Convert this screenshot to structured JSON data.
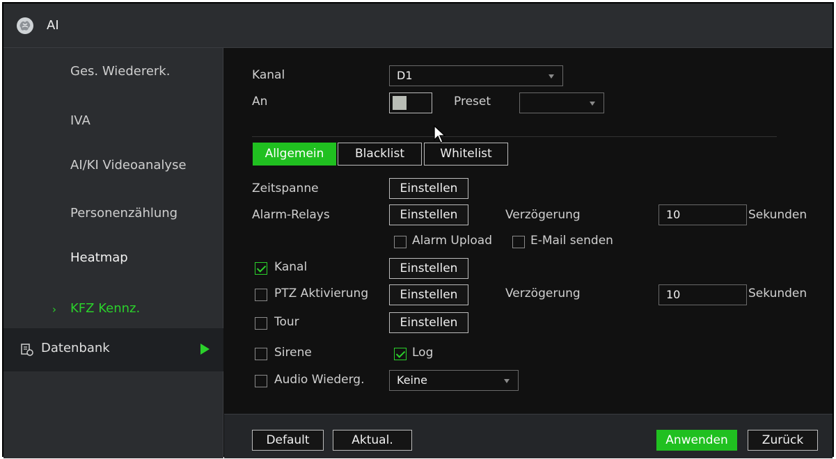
{
  "app": {
    "title": "AI",
    "logo_icon": "brain-icon"
  },
  "sidebar": {
    "items": [
      {
        "label": "Ges. Wiedererk."
      },
      {
        "label": "IVA"
      },
      {
        "label": "AI/KI Videoanalyse"
      },
      {
        "label": "Personenzählung"
      },
      {
        "label": "Heatmap"
      },
      {
        "label": "KFZ Kennz.",
        "active": true
      }
    ],
    "active_chevron": "›",
    "database": {
      "label": "Datenbank",
      "icon": "database-icon",
      "arrow_icon": "play-arrow-icon"
    }
  },
  "form": {
    "kanal_label": "Kanal",
    "kanal_value": "D1",
    "an_label": "An",
    "preset_label": "Preset",
    "preset_value": "",
    "toggle_on": false
  },
  "tabs": [
    {
      "label": "Allgemein",
      "active": true
    },
    {
      "label": "Blacklist",
      "active": false
    },
    {
      "label": "Whitelist",
      "active": false
    }
  ],
  "general": {
    "zeitspanne_label": "Zeitspanne",
    "alarm_relays_label": "Alarm-Relays",
    "einstellen": "Einstellen",
    "verzoegerung_label": "Verzögerung",
    "relay_delay_value": "10",
    "seconds_label": "Sekunden",
    "alarm_upload_label": "Alarm Upload",
    "alarm_upload_checked": false,
    "email_label": "E-Mail senden",
    "email_checked": false,
    "kanal_label": "Kanal",
    "kanal_checked": true,
    "ptz_label": "PTZ Aktivierung",
    "ptz_checked": false,
    "ptz_delay_value": "10",
    "tour_label": "Tour",
    "tour_checked": false,
    "sirene_label": "Sirene",
    "sirene_checked": false,
    "log_label": "Log",
    "log_checked": true,
    "audio_label": "Audio Wiederg.",
    "audio_checked": false,
    "audio_value": "Keine"
  },
  "footer": {
    "default_label": "Default",
    "refresh_label": "Aktual.",
    "apply_label": "Anwenden",
    "back_label": "Zurück"
  },
  "colors": {
    "accent": "#20c020",
    "background": "#111111",
    "panel": "#2b2d30"
  }
}
